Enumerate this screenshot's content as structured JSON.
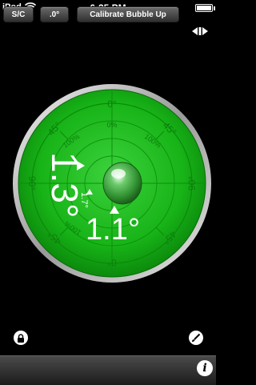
{
  "status_bar": {
    "carrier": "iPod",
    "time": "6:35 PM"
  },
  "level": {
    "ring_labels": {
      "top": "0°",
      "bottom": "0°",
      "left": "90°",
      "right": "90°",
      "top_left": "45°",
      "top_right": "45°",
      "bottom_left": "45°",
      "bottom_right": "45°"
    },
    "percent_labels": {
      "top": "0%",
      "top_right": "100%",
      "top_left": "100%",
      "bottom_left": "100%"
    },
    "reading_vertical": "1.3°",
    "reading_horizontal": "1.1°",
    "reading_small": "1.7°",
    "colors": {
      "body": "#18b218",
      "rim": "#d8d8d8",
      "bubble": "#2f9a2f"
    }
  },
  "toolbar": {
    "sc_label": "S/C",
    "decimal_label": ".0°",
    "calibrate_label": "Calibrate Bubble Up",
    "info_label": "i"
  },
  "icons": [
    "wifi-icon",
    "battery-icon",
    "toggle-arrows-icon",
    "lock-icon",
    "brush-icon",
    "info-icon"
  ]
}
